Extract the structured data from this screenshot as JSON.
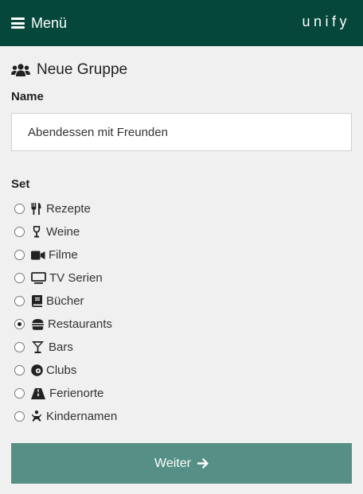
{
  "header": {
    "menu_label": "Menü",
    "brand": "unify",
    "color": "#05473a"
  },
  "form": {
    "title": "Neue Gruppe",
    "title_icon": "users-icon",
    "name_label": "Name",
    "name_value": "Abendessen mit Freunden",
    "set_label": "Set",
    "options": [
      {
        "label": "Rezepte",
        "icon": "utensils-icon",
        "checked": false
      },
      {
        "label": "Weine",
        "icon": "wine-glass-icon",
        "checked": false
      },
      {
        "label": "Filme",
        "icon": "video-camera-icon",
        "checked": false
      },
      {
        "label": "TV Serien",
        "icon": "tv-icon",
        "checked": false
      },
      {
        "label": "Bücher",
        "icon": "book-icon",
        "checked": false
      },
      {
        "label": "Restaurants",
        "icon": "hamburger-icon",
        "checked": true
      },
      {
        "label": "Bars",
        "icon": "cocktail-icon",
        "checked": false
      },
      {
        "label": "Clubs",
        "icon": "record-icon",
        "checked": false
      },
      {
        "label": "Ferienorte",
        "icon": "road-icon",
        "checked": false
      },
      {
        "label": "Kindernamen",
        "icon": "baby-icon",
        "checked": false
      }
    ],
    "submit_label": "Weiter",
    "submit_color": "#558f85"
  }
}
